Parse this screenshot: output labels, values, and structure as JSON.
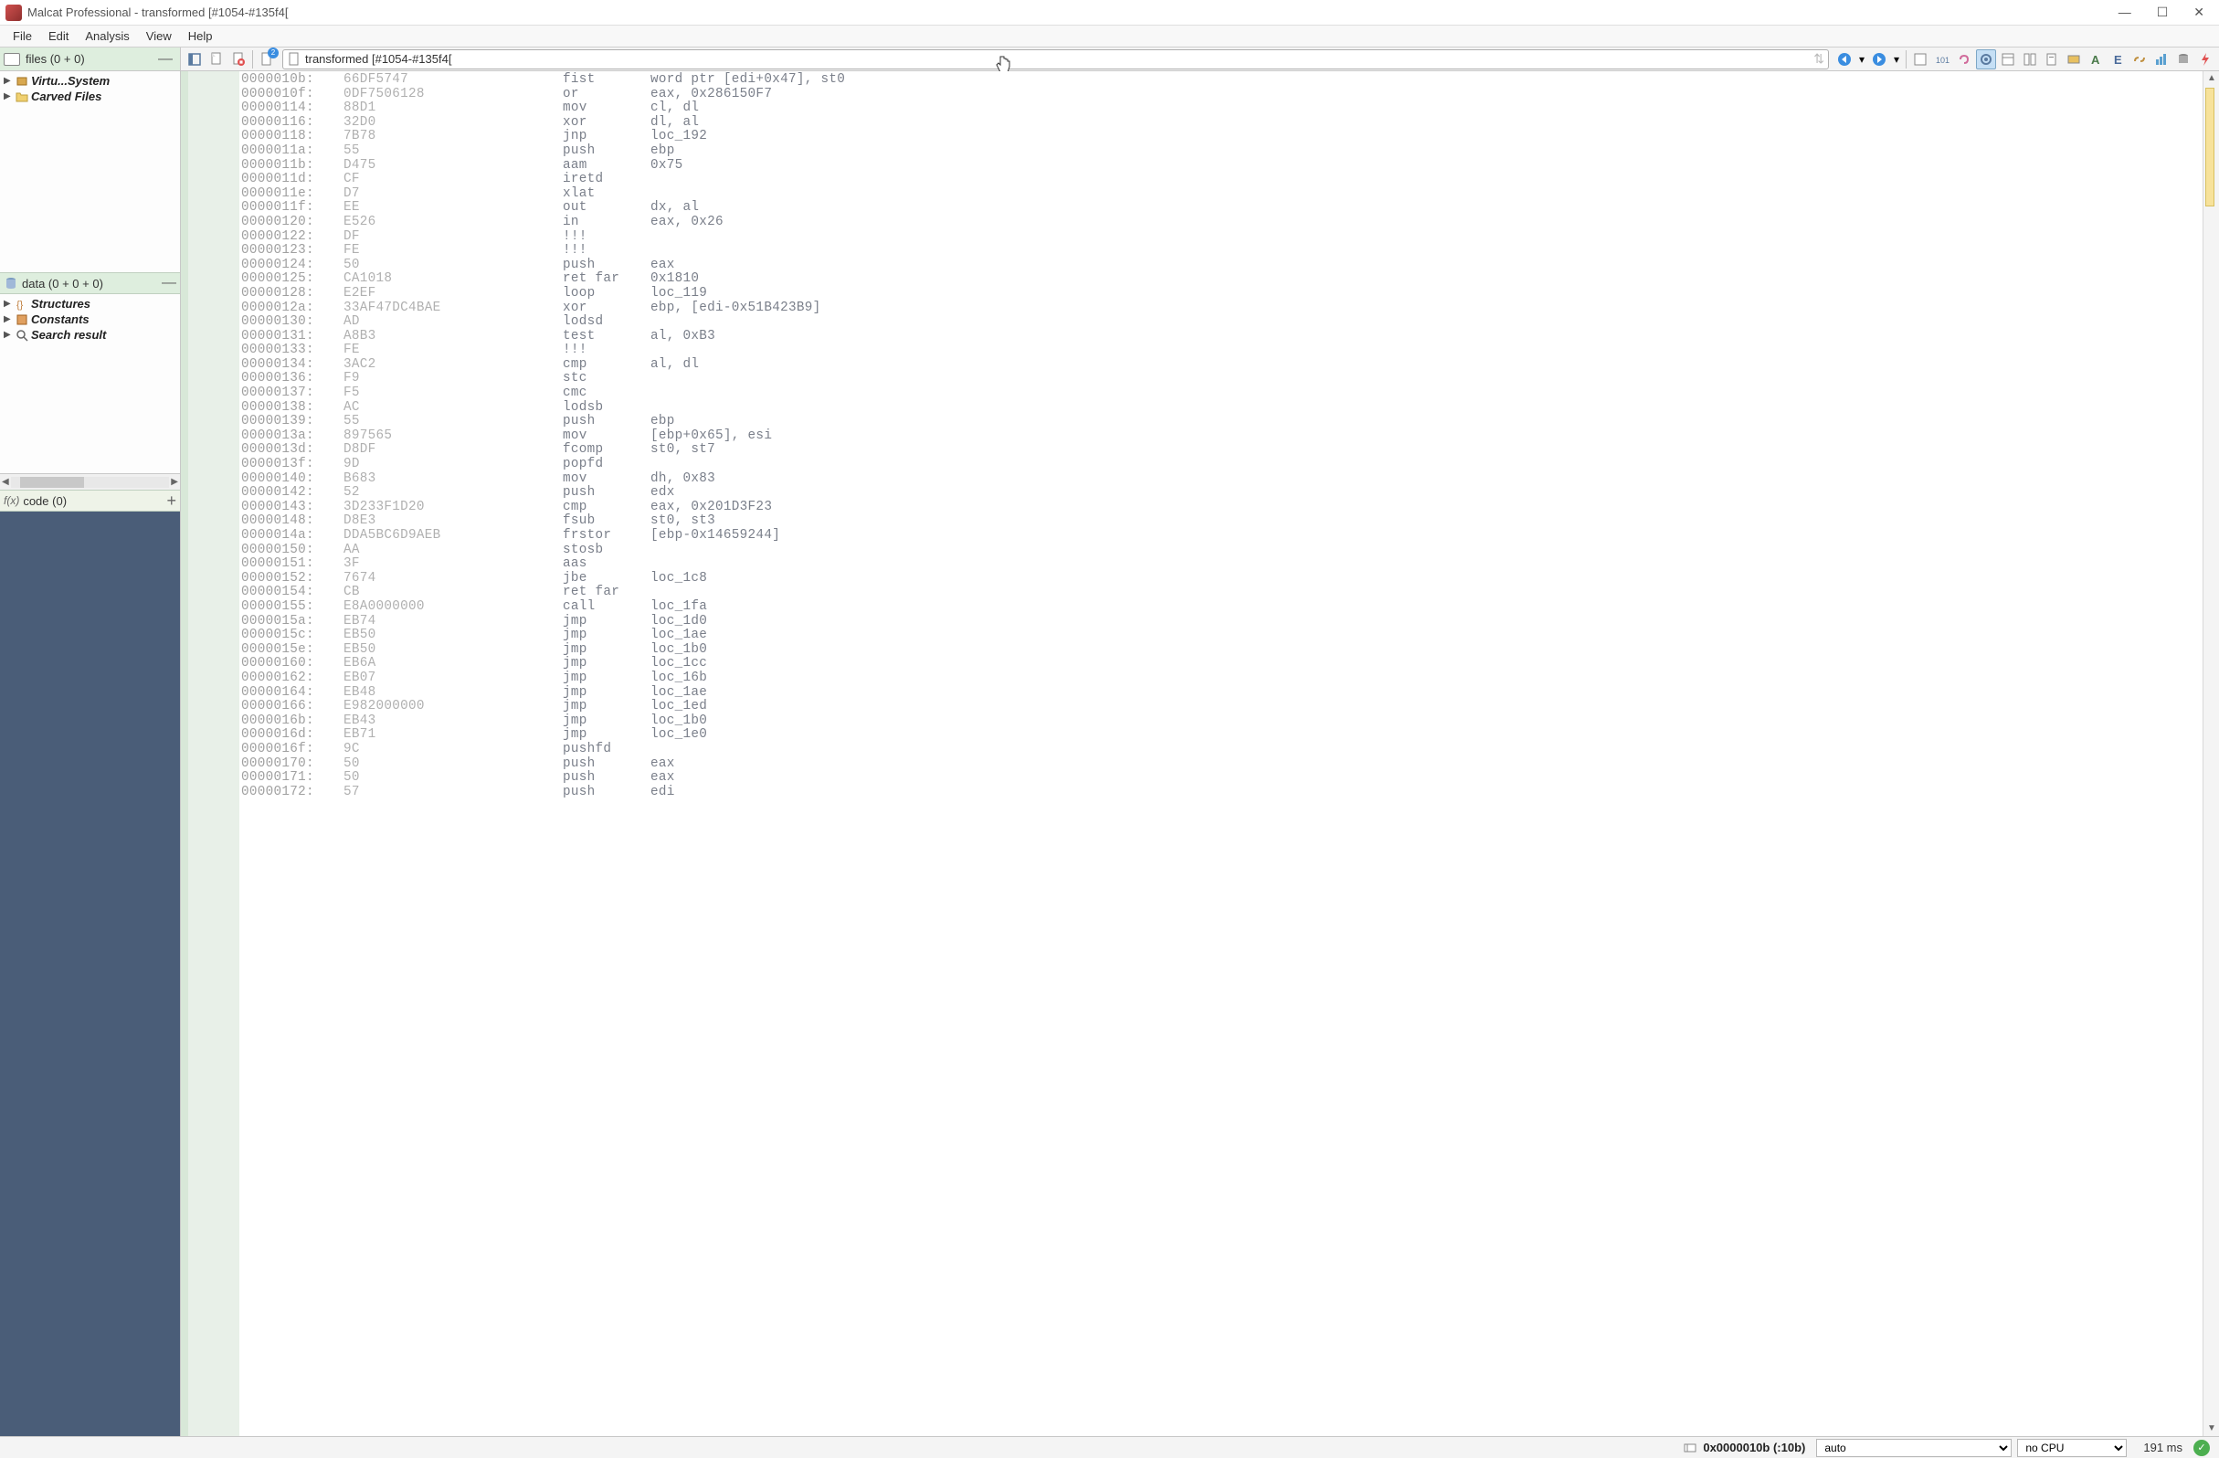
{
  "window": {
    "title": "Malcat Professional - transformed [#1054-#135f4["
  },
  "menu": [
    "File",
    "Edit",
    "Analysis",
    "View",
    "Help"
  ],
  "files_panel": {
    "title": "files (0 + 0)",
    "items": [
      {
        "label": "Virtu...System",
        "icon": "box"
      },
      {
        "label": "Carved Files",
        "icon": "folder"
      }
    ]
  },
  "data_panel": {
    "title": "data (0 + 0 + 0)",
    "items": [
      {
        "label": "Structures",
        "icon": "braces"
      },
      {
        "label": "Constants",
        "icon": "const"
      },
      {
        "label": "Search result",
        "icon": "search"
      }
    ]
  },
  "code_panel": {
    "title": "code (0)",
    "prefix": "f(x)"
  },
  "address_bar": {
    "text": "transformed [#1054-#135f4[",
    "badge": "2"
  },
  "disassembly": [
    {
      "addr": "0000010b:",
      "bytes": "66DF5747",
      "mnem": "fist",
      "ops": "word ptr [edi+0x47], st0"
    },
    {
      "addr": "0000010f:",
      "bytes": "0DF7506128",
      "mnem": "or",
      "ops": "eax, 0x286150F7"
    },
    {
      "addr": "00000114:",
      "bytes": "88D1",
      "mnem": "mov",
      "ops": "cl, dl"
    },
    {
      "addr": "00000116:",
      "bytes": "32D0",
      "mnem": "xor",
      "ops": "dl, al"
    },
    {
      "addr": "00000118:",
      "bytes": "7B78",
      "mnem": "jnp",
      "ops": "loc_192"
    },
    {
      "addr": "0000011a:",
      "bytes": "55",
      "mnem": "push",
      "ops": "ebp"
    },
    {
      "addr": "0000011b:",
      "bytes": "D475",
      "mnem": "aam",
      "ops": "0x75"
    },
    {
      "addr": "0000011d:",
      "bytes": "CF",
      "mnem": "iretd",
      "ops": ""
    },
    {
      "addr": "0000011e:",
      "bytes": "D7",
      "mnem": "xlat",
      "ops": ""
    },
    {
      "addr": "0000011f:",
      "bytes": "EE",
      "mnem": "out",
      "ops": "dx, al"
    },
    {
      "addr": "00000120:",
      "bytes": "E526",
      "mnem": "in",
      "ops": "eax, 0x26"
    },
    {
      "addr": "00000122:",
      "bytes": "DF",
      "mnem": "!!!",
      "ops": ""
    },
    {
      "addr": "00000123:",
      "bytes": "FE",
      "mnem": "!!!",
      "ops": ""
    },
    {
      "addr": "00000124:",
      "bytes": "50",
      "mnem": "push",
      "ops": "eax"
    },
    {
      "addr": "00000125:",
      "bytes": "CA1018",
      "mnem": "ret far",
      "ops": "0x1810"
    },
    {
      "addr": "00000128:",
      "bytes": "E2EF",
      "mnem": "loop",
      "ops": "loc_119"
    },
    {
      "addr": "0000012a:",
      "bytes": "33AF47DC4BAE",
      "mnem": "xor",
      "ops": "ebp, [edi-0x51B423B9]"
    },
    {
      "addr": "00000130:",
      "bytes": "AD",
      "mnem": "lodsd",
      "ops": ""
    },
    {
      "addr": "00000131:",
      "bytes": "A8B3",
      "mnem": "test",
      "ops": "al, 0xB3"
    },
    {
      "addr": "00000133:",
      "bytes": "FE",
      "mnem": "!!!",
      "ops": ""
    },
    {
      "addr": "00000134:",
      "bytes": "3AC2",
      "mnem": "cmp",
      "ops": "al, dl"
    },
    {
      "addr": "00000136:",
      "bytes": "F9",
      "mnem": "stc",
      "ops": ""
    },
    {
      "addr": "00000137:",
      "bytes": "F5",
      "mnem": "cmc",
      "ops": ""
    },
    {
      "addr": "00000138:",
      "bytes": "AC",
      "mnem": "lodsb",
      "ops": ""
    },
    {
      "addr": "00000139:",
      "bytes": "55",
      "mnem": "push",
      "ops": "ebp"
    },
    {
      "addr": "0000013a:",
      "bytes": "897565",
      "mnem": "mov",
      "ops": "[ebp+0x65], esi"
    },
    {
      "addr": "0000013d:",
      "bytes": "D8DF",
      "mnem": "fcomp",
      "ops": "st0, st7"
    },
    {
      "addr": "0000013f:",
      "bytes": "9D",
      "mnem": "popfd",
      "ops": ""
    },
    {
      "addr": "00000140:",
      "bytes": "B683",
      "mnem": "mov",
      "ops": "dh, 0x83"
    },
    {
      "addr": "00000142:",
      "bytes": "52",
      "mnem": "push",
      "ops": "edx"
    },
    {
      "addr": "00000143:",
      "bytes": "3D233F1D20",
      "mnem": "cmp",
      "ops": "eax, 0x201D3F23"
    },
    {
      "addr": "00000148:",
      "bytes": "D8E3",
      "mnem": "fsub",
      "ops": "st0, st3"
    },
    {
      "addr": "0000014a:",
      "bytes": "DDA5BC6D9AEB",
      "mnem": "frstor",
      "ops": "[ebp-0x14659244]"
    },
    {
      "addr": "00000150:",
      "bytes": "AA",
      "mnem": "stosb",
      "ops": ""
    },
    {
      "addr": "00000151:",
      "bytes": "3F",
      "mnem": "aas",
      "ops": ""
    },
    {
      "addr": "00000152:",
      "bytes": "7674",
      "mnem": "jbe",
      "ops": "loc_1c8"
    },
    {
      "addr": "00000154:",
      "bytes": "CB",
      "mnem": "ret far",
      "ops": ""
    },
    {
      "addr": "00000155:",
      "bytes": "E8A0000000",
      "mnem": "call",
      "ops": "loc_1fa"
    },
    {
      "addr": "0000015a:",
      "bytes": "EB74",
      "mnem": "jmp",
      "ops": "loc_1d0"
    },
    {
      "addr": "0000015c:",
      "bytes": "EB50",
      "mnem": "jmp",
      "ops": "loc_1ae"
    },
    {
      "addr": "0000015e:",
      "bytes": "EB50",
      "mnem": "jmp",
      "ops": "loc_1b0"
    },
    {
      "addr": "00000160:",
      "bytes": "EB6A",
      "mnem": "jmp",
      "ops": "loc_1cc"
    },
    {
      "addr": "00000162:",
      "bytes": "EB07",
      "mnem": "jmp",
      "ops": "loc_16b"
    },
    {
      "addr": "00000164:",
      "bytes": "EB48",
      "mnem": "jmp",
      "ops": "loc_1ae"
    },
    {
      "addr": "00000166:",
      "bytes": "E982000000",
      "mnem": "jmp",
      "ops": "loc_1ed"
    },
    {
      "addr": "0000016b:",
      "bytes": "EB43",
      "mnem": "jmp",
      "ops": "loc_1b0"
    },
    {
      "addr": "0000016d:",
      "bytes": "EB71",
      "mnem": "jmp",
      "ops": "loc_1e0"
    },
    {
      "addr": "0000016f:",
      "bytes": "9C",
      "mnem": "pushfd",
      "ops": ""
    },
    {
      "addr": "00000170:",
      "bytes": "50",
      "mnem": "push",
      "ops": "eax"
    },
    {
      "addr": "00000171:",
      "bytes": "50",
      "mnem": "push",
      "ops": "eax"
    },
    {
      "addr": "00000172:",
      "bytes": "57",
      "mnem": "push",
      "ops": "edi"
    }
  ],
  "status": {
    "position": "0x0000010b (:10b)",
    "select1": "auto",
    "select2": "no CPU",
    "time": "191 ms"
  }
}
